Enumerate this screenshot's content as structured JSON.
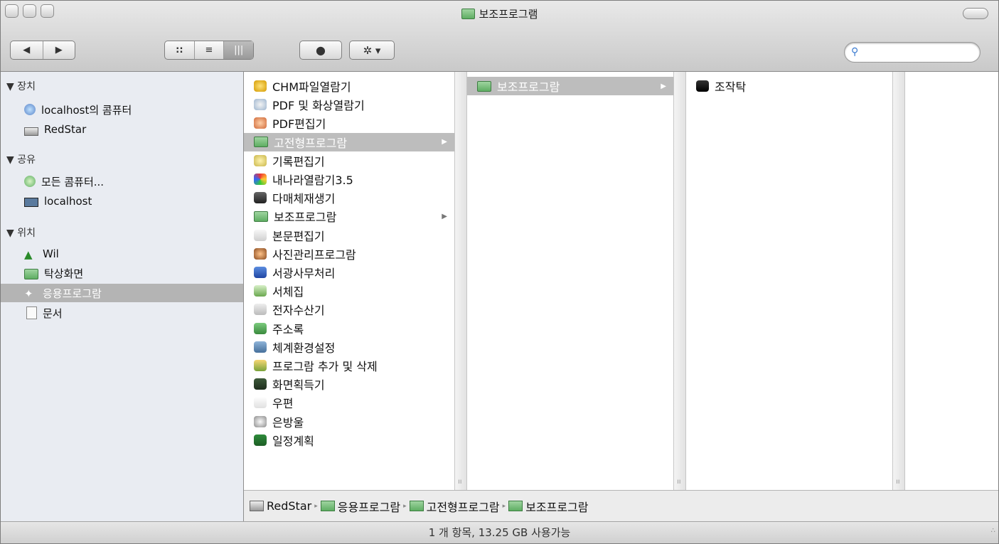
{
  "window": {
    "title": "보조프로그램",
    "title_icon": "green-folder-icon"
  },
  "toolbar": {
    "back_icon": "◀",
    "forward_icon": "▶",
    "view_icon_mode": "::",
    "view_list_mode": "≡",
    "view_column_mode": "|||",
    "quicklook_icon": "●",
    "action_icon": "✲ ▾",
    "search_placeholder": "",
    "search_icon": "🔍"
  },
  "sidebar": {
    "sections": [
      {
        "header": "▼ 장치",
        "items": [
          "localhost의 콤퓨터",
          "RedStar"
        ]
      },
      {
        "header": "▼ 공유",
        "items": [
          "모든 콤퓨터...",
          "localhost"
        ]
      },
      {
        "header": "▼ 위치",
        "items": [
          "Wil",
          "탁상화면",
          "응용프로그람",
          "문서"
        ]
      }
    ],
    "selected": "응용프로그람"
  },
  "columns": {
    "col1": [
      {
        "label": "CHM파일열람기",
        "icon": "chm-icon"
      },
      {
        "label": "PDF 및 화상열람기",
        "icon": "pdf-viewer-icon"
      },
      {
        "label": "PDF편집기",
        "icon": "pdf-editor-icon"
      },
      {
        "label": "고전형프로그람",
        "icon": "folder-icon",
        "selected": true,
        "arrow": "▶"
      },
      {
        "label": "기록편집기",
        "icon": "note-icon"
      },
      {
        "label": "내나라열람기3.5",
        "icon": "browser-icon"
      },
      {
        "label": "다매체재생기",
        "icon": "media-icon"
      },
      {
        "label": "보조프로그람",
        "icon": "folder-icon",
        "arrow": "▶"
      },
      {
        "label": "본문편집기",
        "icon": "text-edit-icon"
      },
      {
        "label": "사진관리프로그람",
        "icon": "photo-icon"
      },
      {
        "label": "서광사무처리",
        "icon": "office-icon"
      },
      {
        "label": "서체집",
        "icon": "font-icon"
      },
      {
        "label": "전자수산기",
        "icon": "calculator-icon"
      },
      {
        "label": "주소록",
        "icon": "addressbook-icon"
      },
      {
        "label": "체계환경설정",
        "icon": "settings-icon"
      },
      {
        "label": "프로그람 추가 및 삭제",
        "icon": "installer-icon"
      },
      {
        "label": "화면획득기",
        "icon": "screenshot-icon"
      },
      {
        "label": "우편",
        "icon": "mail-icon"
      },
      {
        "label": "은방울",
        "icon": "bell-icon"
      },
      {
        "label": "일정계획",
        "icon": "calendar-icon"
      }
    ],
    "col2": [
      {
        "label": "보조프로그람",
        "icon": "folder-icon",
        "selected": true,
        "arrow": "▶"
      }
    ],
    "col3": [
      {
        "label": "조작탁",
        "icon": "terminal-icon"
      }
    ]
  },
  "pathbar": [
    "RedStar",
    "응용프로그람",
    "고전형프로그람",
    "보조프로그람"
  ],
  "status": "1 개 항목, 13.25 GB 사용가능"
}
